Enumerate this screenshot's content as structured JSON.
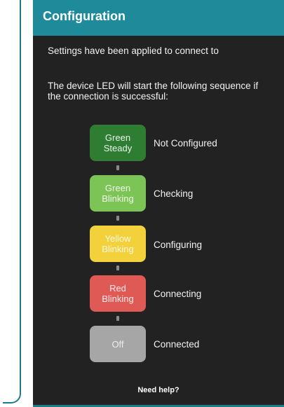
{
  "header": {
    "title": "Configuration"
  },
  "message": {
    "line1": "Settings have been applied to connect to",
    "line2": "The device LED will start the following sequence if the connection is successful:"
  },
  "colors": {
    "header": "#1f8a9a",
    "background": "#222222"
  },
  "sequence": [
    {
      "led": "Green Steady",
      "status": "Not Configured",
      "color": "#2e7d32",
      "text_color": "#e8f5e9"
    },
    {
      "led": "Green Blinking",
      "status": "Checking",
      "color": "#7cc456",
      "text_color": "#f1f8e9"
    },
    {
      "led": "Yellow Blinking",
      "status": "Configuring",
      "color": "#f2d13c",
      "text_color": "#fff8dc"
    },
    {
      "led": "Red Blinking",
      "status": "Connecting",
      "color": "#df5a55",
      "text_color": "#ffebee"
    },
    {
      "led": "Off",
      "status": "Connected",
      "color": "#a6a6a6",
      "text_color": "#eeeeee"
    }
  ],
  "footer": {
    "help": "Need help?"
  }
}
